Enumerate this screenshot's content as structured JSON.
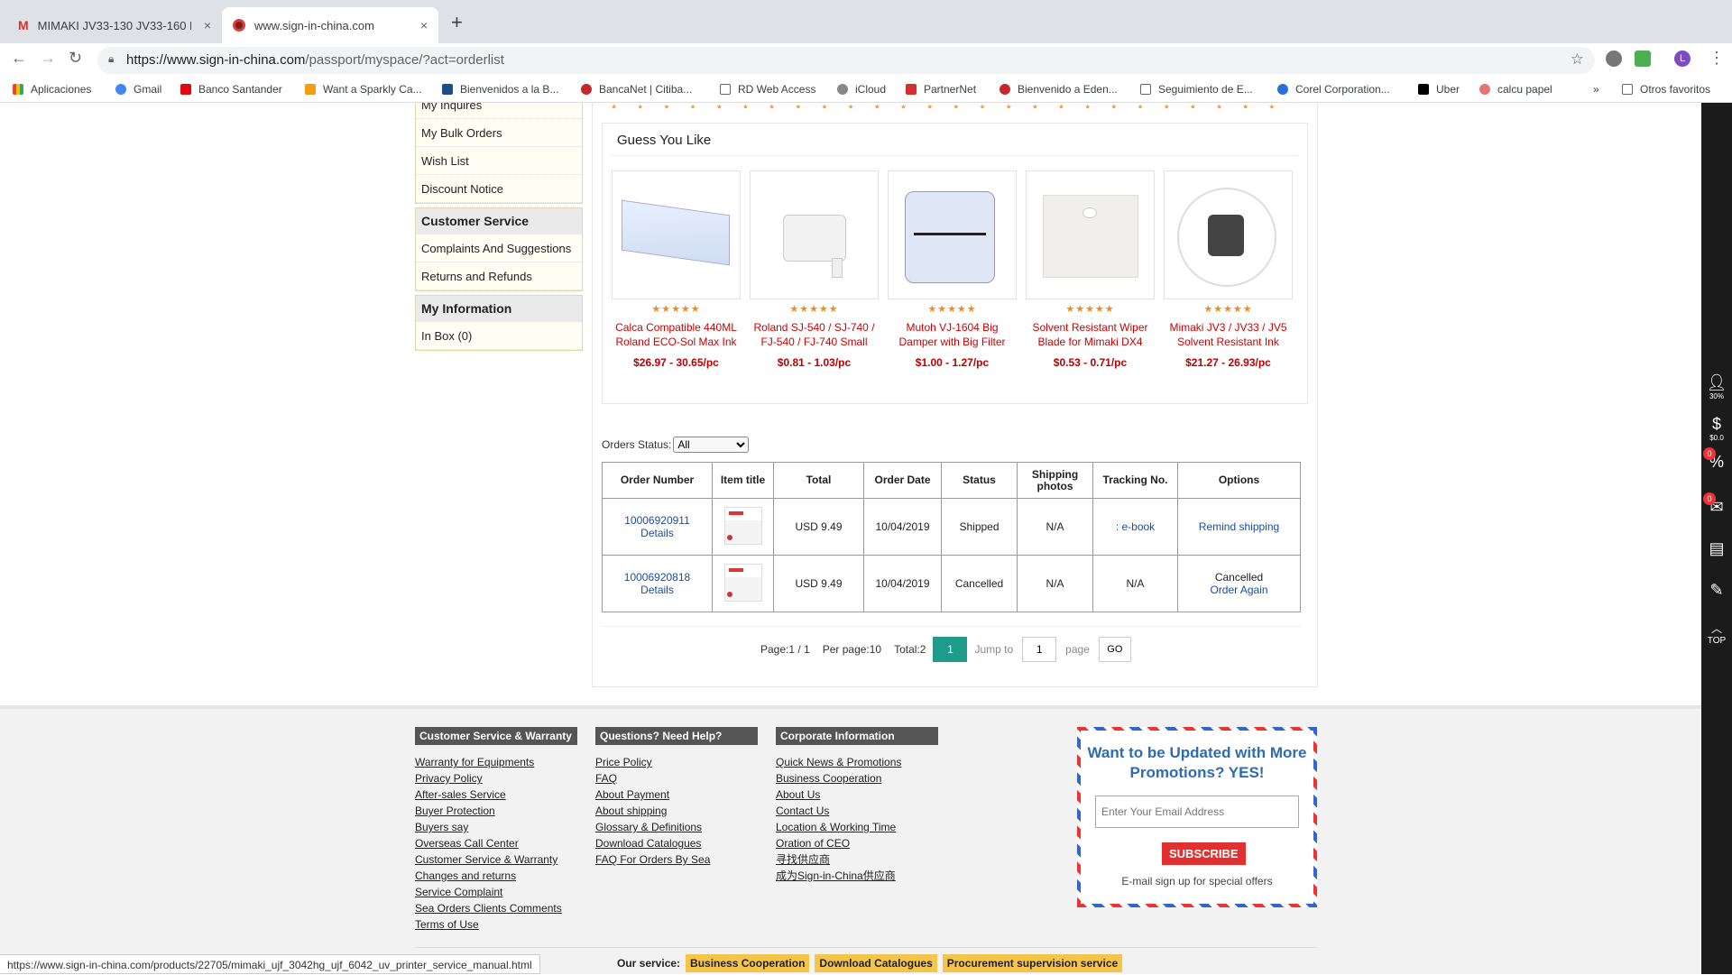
{
  "browser": {
    "tabs": [
      {
        "title": "MIMAKI JV33-130 JV33-160 P",
        "close": "×"
      },
      {
        "title": "www.sign-in-china.com",
        "close": "×"
      }
    ],
    "new_tab": "+",
    "url_host": "https://www.sign-in-china.com",
    "url_path": "/passport/myspace/?act=orderlist",
    "profile_initial": "L",
    "bookmarks": [
      "Aplicaciones",
      "Gmail",
      "Banco Santander",
      "Want a Sparkly Ca...",
      "Bienvenidos a la B...",
      "BancaNet | Citiba...",
      "RD Web Access",
      "iCloud",
      "PartnerNet",
      "Bienvenido a Eden...",
      "Seguimiento de E...",
      "Corel Corporation...",
      "Uber",
      "calcu papel"
    ],
    "bookmarks_more": "»",
    "other_bookmarks": "Otros favoritos"
  },
  "left_menu": {
    "account_items": [
      "My Inquires",
      "My Bulk Orders",
      "Wish List",
      "Discount Notice"
    ],
    "customer_service": {
      "title": "Customer Service",
      "items": [
        "Complaints And Suggestions",
        "Returns and Refunds"
      ]
    },
    "my_information": {
      "title": "My Information",
      "items": [
        "In Box (0)"
      ]
    }
  },
  "guess": {
    "title": "Guess You Like",
    "stars": "★★★★★",
    "products": [
      {
        "name": "Calca Compatible 440ML Roland ECO-Sol Max Ink",
        "price": "$26.97 - 30.65/pc"
      },
      {
        "name": "Roland SJ-540 / SJ-740 / FJ-540 / FJ-740 Small",
        "price": "$0.81 - 1.03/pc"
      },
      {
        "name": "Mutoh VJ-1604 Big Damper with Big Filter",
        "price": "$1.00 - 1.27/pc"
      },
      {
        "name": "Solvent Resistant Wiper Blade for Mimaki DX4",
        "price": "$0.53 - 0.71/pc"
      },
      {
        "name": "Mimaki JV3 / JV33 / JV5 Solvent Resistant Ink",
        "price": "$21.27 - 26.93/pc"
      }
    ]
  },
  "orders": {
    "status_label": "Orders Status:",
    "status_value": "All",
    "headers": {
      "order_number": "Order Number",
      "item_title": "Item title",
      "total": "Total",
      "order_date": "Order Date",
      "status": "Status",
      "shipping_photos": "Shipping photos",
      "tracking": "Tracking No.",
      "options": "Options"
    },
    "rows": [
      {
        "number": "10006920911",
        "details": "Details",
        "total": "USD 9.49",
        "date": "10/04/2019",
        "status": "Shipped",
        "photos": "N/A",
        "tracking": ": e-book",
        "option1": "Remind shipping",
        "option2": ""
      },
      {
        "number": "10006920818",
        "details": "Details",
        "total": "USD 9.49",
        "date": "10/04/2019",
        "status": "Cancelled",
        "photos": "N/A",
        "tracking": "N/A",
        "option1": "Cancelled",
        "option2": "Order Again"
      }
    ],
    "pager": {
      "page": "Page:1 / 1",
      "per_page": "Per page:10",
      "total": "Total:2",
      "current": "1",
      "jump_label": "Jump to",
      "jump_value": "1",
      "page_label": "page",
      "go": "GO"
    }
  },
  "footer": {
    "col1": {
      "title": "Customer Service & Warranty",
      "links": [
        "Warranty for Equipments",
        "Privacy Policy",
        "After-sales Service",
        "Buyer Protection",
        "Buyers say",
        "Overseas Call Center",
        "Customer Service & Warranty",
        "Changes and returns",
        "Service Complaint",
        "Sea Orders Clients Comments",
        "Terms of Use"
      ]
    },
    "col2": {
      "title": "Questions? Need Help?",
      "links": [
        "Price Policy",
        "FAQ",
        "About Payment",
        "About shipping",
        "Glossary & Definitions",
        "Download Catalogues",
        "FAQ For Orders By Sea"
      ]
    },
    "col3": {
      "title": "Corporate Information",
      "links": [
        "Quick News & Promotions",
        "Business Cooperation",
        "About Us",
        "Contact Us",
        "Location & Working Time",
        "Oration of CEO",
        "寻找供应商",
        "成为Sign-in-China供应商"
      ]
    },
    "promo": {
      "title": "Want to be Updated with More Promotions? YES!",
      "placeholder": "Enter Your Email Address",
      "subscribe": "SUBSCRIBE",
      "note": "E-mail sign up for special offers"
    },
    "service_label": "Our service:",
    "service_tags": [
      "Business Cooperation",
      "Download Catalogues",
      "Procurement supervision service"
    ]
  },
  "side_tools": {
    "discount": "30%",
    "money": "$0.0",
    "badge1": "0",
    "badge2": "0",
    "top": "TOP"
  },
  "status_url": "https://www.sign-in-china.com/products/22705/mimaki_ujf_3042hg_ujf_6042_uv_printer_service_manual.html"
}
